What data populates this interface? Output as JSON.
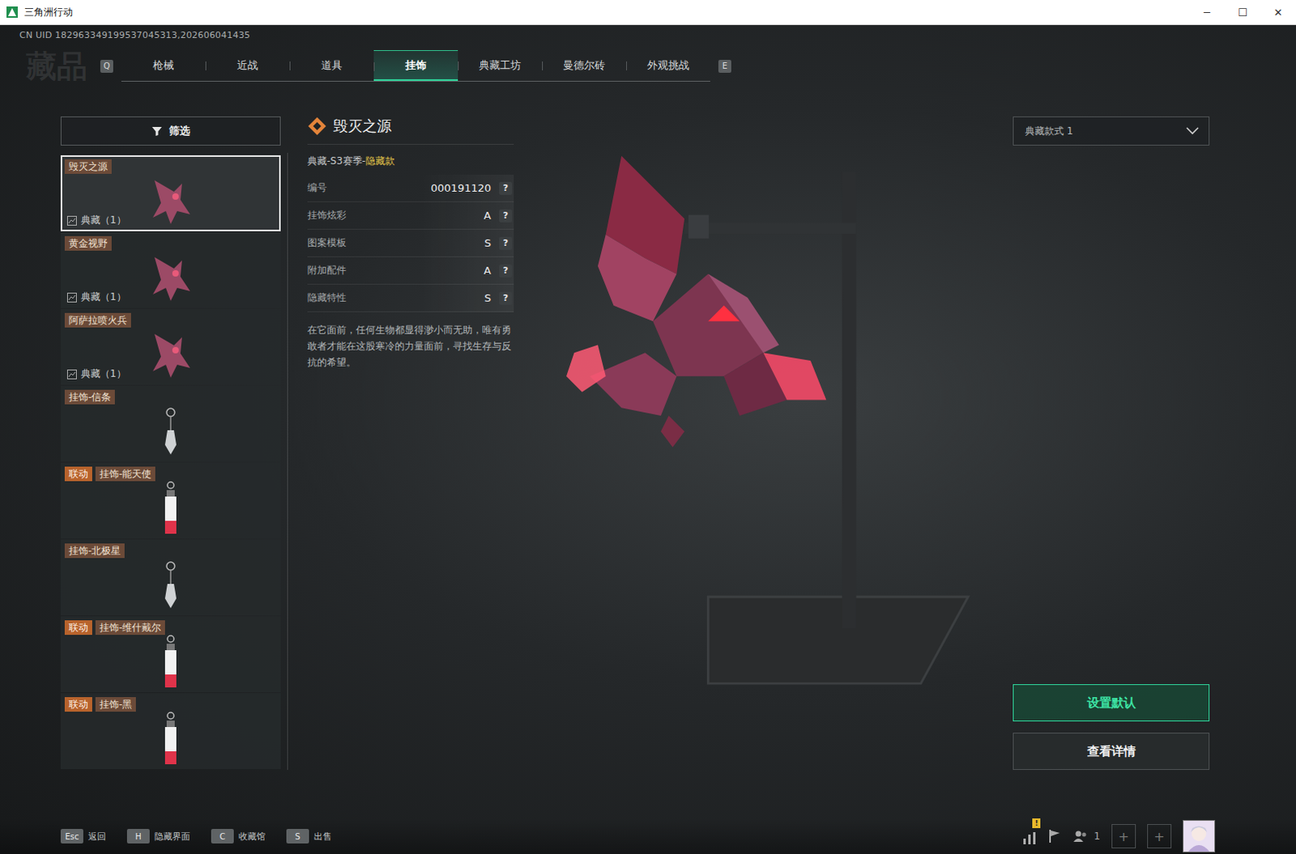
{
  "window": {
    "title": "三角洲行动",
    "controls": [
      "─",
      "☐",
      "✕"
    ]
  },
  "uid": "CN UID 182963349199537045313,202606041435",
  "watermark": "藏品",
  "tabs": {
    "prev_key": "Q",
    "next_key": "E",
    "items": [
      {
        "label": "枪械",
        "selected": false
      },
      {
        "label": "近战",
        "selected": false
      },
      {
        "label": "道具",
        "selected": false
      },
      {
        "label": "挂饰",
        "selected": true
      },
      {
        "label": "典藏工坊",
        "selected": false
      },
      {
        "label": "曼德尔砖",
        "selected": false
      },
      {
        "label": "外观挑战",
        "selected": false
      }
    ]
  },
  "filter": {
    "label": "筛选"
  },
  "items": [
    {
      "name": "毁灭之源",
      "tag": "",
      "count": "典藏（1）",
      "kind": "figure",
      "selected": true
    },
    {
      "name": "黄金视野",
      "tag": "",
      "count": "典藏（1）",
      "kind": "figure",
      "selected": false
    },
    {
      "name": "阿萨拉喷火兵",
      "tag": "",
      "count": "典藏（1）",
      "kind": "figure",
      "selected": false
    },
    {
      "name": "挂饰-信条",
      "tag": "",
      "count": "",
      "kind": "charm",
      "selected": false
    },
    {
      "name": "挂饰-能天使",
      "tag": "联动",
      "count": "",
      "kind": "card",
      "selected": false
    },
    {
      "name": "挂饰-北极星",
      "tag": "",
      "count": "",
      "kind": "charm",
      "selected": false
    },
    {
      "name": "挂饰-维什戴尔",
      "tag": "联动",
      "count": "",
      "kind": "card",
      "selected": false
    },
    {
      "name": "挂饰-黑",
      "tag": "联动",
      "count": "",
      "kind": "card",
      "selected": false
    }
  ],
  "detail": {
    "title": "毁灭之源",
    "category": "典藏-S3赛季-",
    "rarity": "隐藏款",
    "rows": [
      {
        "label": "编号",
        "value": "000191120",
        "help": "?"
      },
      {
        "label": "挂饰炫彩",
        "value": "A",
        "help": "?"
      },
      {
        "label": "图案模板",
        "value": "S",
        "help": "?"
      },
      {
        "label": "附加配件",
        "value": "A",
        "help": "?"
      },
      {
        "label": "隐藏特性",
        "value": "S",
        "help": "?"
      }
    ],
    "description": "在它面前，任何生物都显得渺小而无助，唯有勇敢者才能在这股寒冷的力量面前，寻找生存与反抗的希望。"
  },
  "style_select": {
    "value": "典藏款式 1"
  },
  "buttons": [
    {
      "label": "设置默认",
      "primary": true
    },
    {
      "label": "查看详情",
      "primary": false
    }
  ],
  "hotkeys": [
    {
      "key": "Esc",
      "label": "返回"
    },
    {
      "key": "H",
      "label": "隐藏界面"
    },
    {
      "key": "C",
      "label": "收藏馆"
    },
    {
      "key": "S",
      "label": "出售"
    }
  ],
  "tray": {
    "alert": "!",
    "friends": "1",
    "plus": "+"
  }
}
